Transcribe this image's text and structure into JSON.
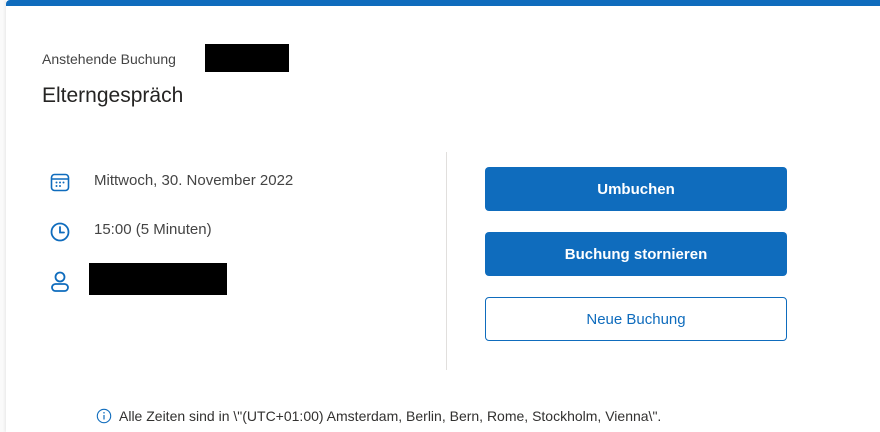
{
  "booking": {
    "pending_label": "Anstehende Buchung",
    "title": "Elterngespräch",
    "date": "Mittwoch, 30. November 2022",
    "time": "15:00 (5 Minuten)"
  },
  "actions": {
    "reschedule": "Umbuchen",
    "cancel": "Buchung stornieren",
    "new_booking": "Neue Buchung"
  },
  "footer": {
    "timezone_note": "Alle Zeiten sind in \\\"(UTC+01:00) Amsterdam, Berlin, Bern, Rome, Stockholm, Vienna\\\"."
  },
  "icons": {
    "date": "calendar-icon",
    "time": "clock-icon",
    "person": "person-icon",
    "info": "info-icon"
  },
  "colors": {
    "accent": "#0f6cbd"
  }
}
